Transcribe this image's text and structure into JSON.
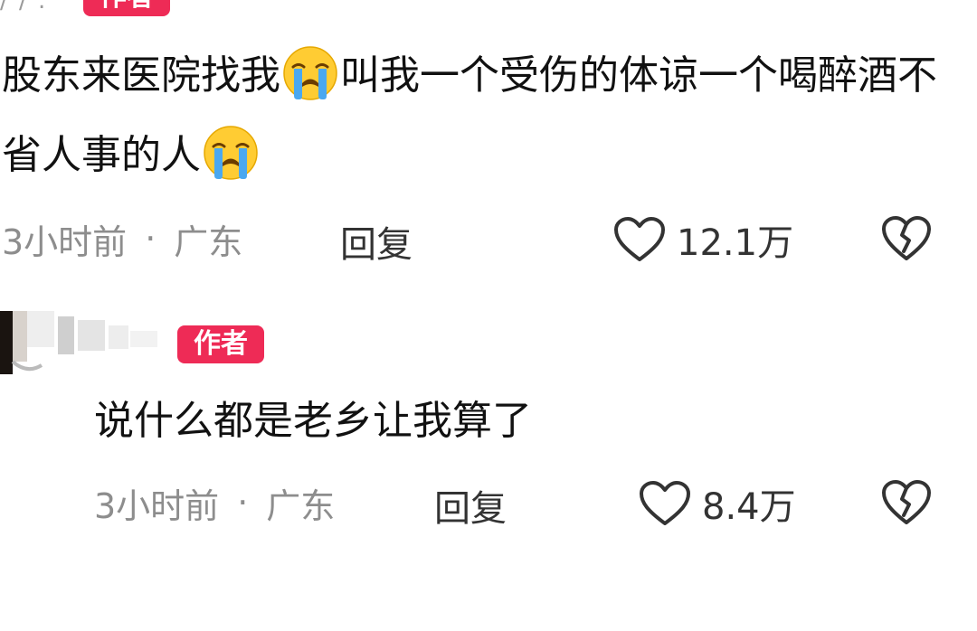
{
  "colors": {
    "author_tag_bg": "#ee2b56",
    "meta_gray": "#8d8d8d",
    "text": "#111111"
  },
  "comment1": {
    "author_tag": "作者",
    "text_part1": "股东来医院找我",
    "emoji1": "loudly-crying-face",
    "text_part2": "叫我一个受伤的体谅一个喝醉酒不省人事的人",
    "emoji2": "loudly-crying-face",
    "time": "3小时前",
    "separator": "·",
    "region": "广东",
    "reply_label": "回复",
    "like_icon": "heart-outline-icon",
    "like_count": "12.1万",
    "dislike_icon": "broken-heart-icon"
  },
  "comment2": {
    "author_tag": "作者",
    "text": "说什么都是老乡让我算了",
    "time": "3小时前",
    "separator": "·",
    "region": "广东",
    "reply_label": "回复",
    "like_icon": "heart-outline-icon",
    "like_count": "8.4万",
    "dislike_icon": "broken-heart-icon"
  }
}
